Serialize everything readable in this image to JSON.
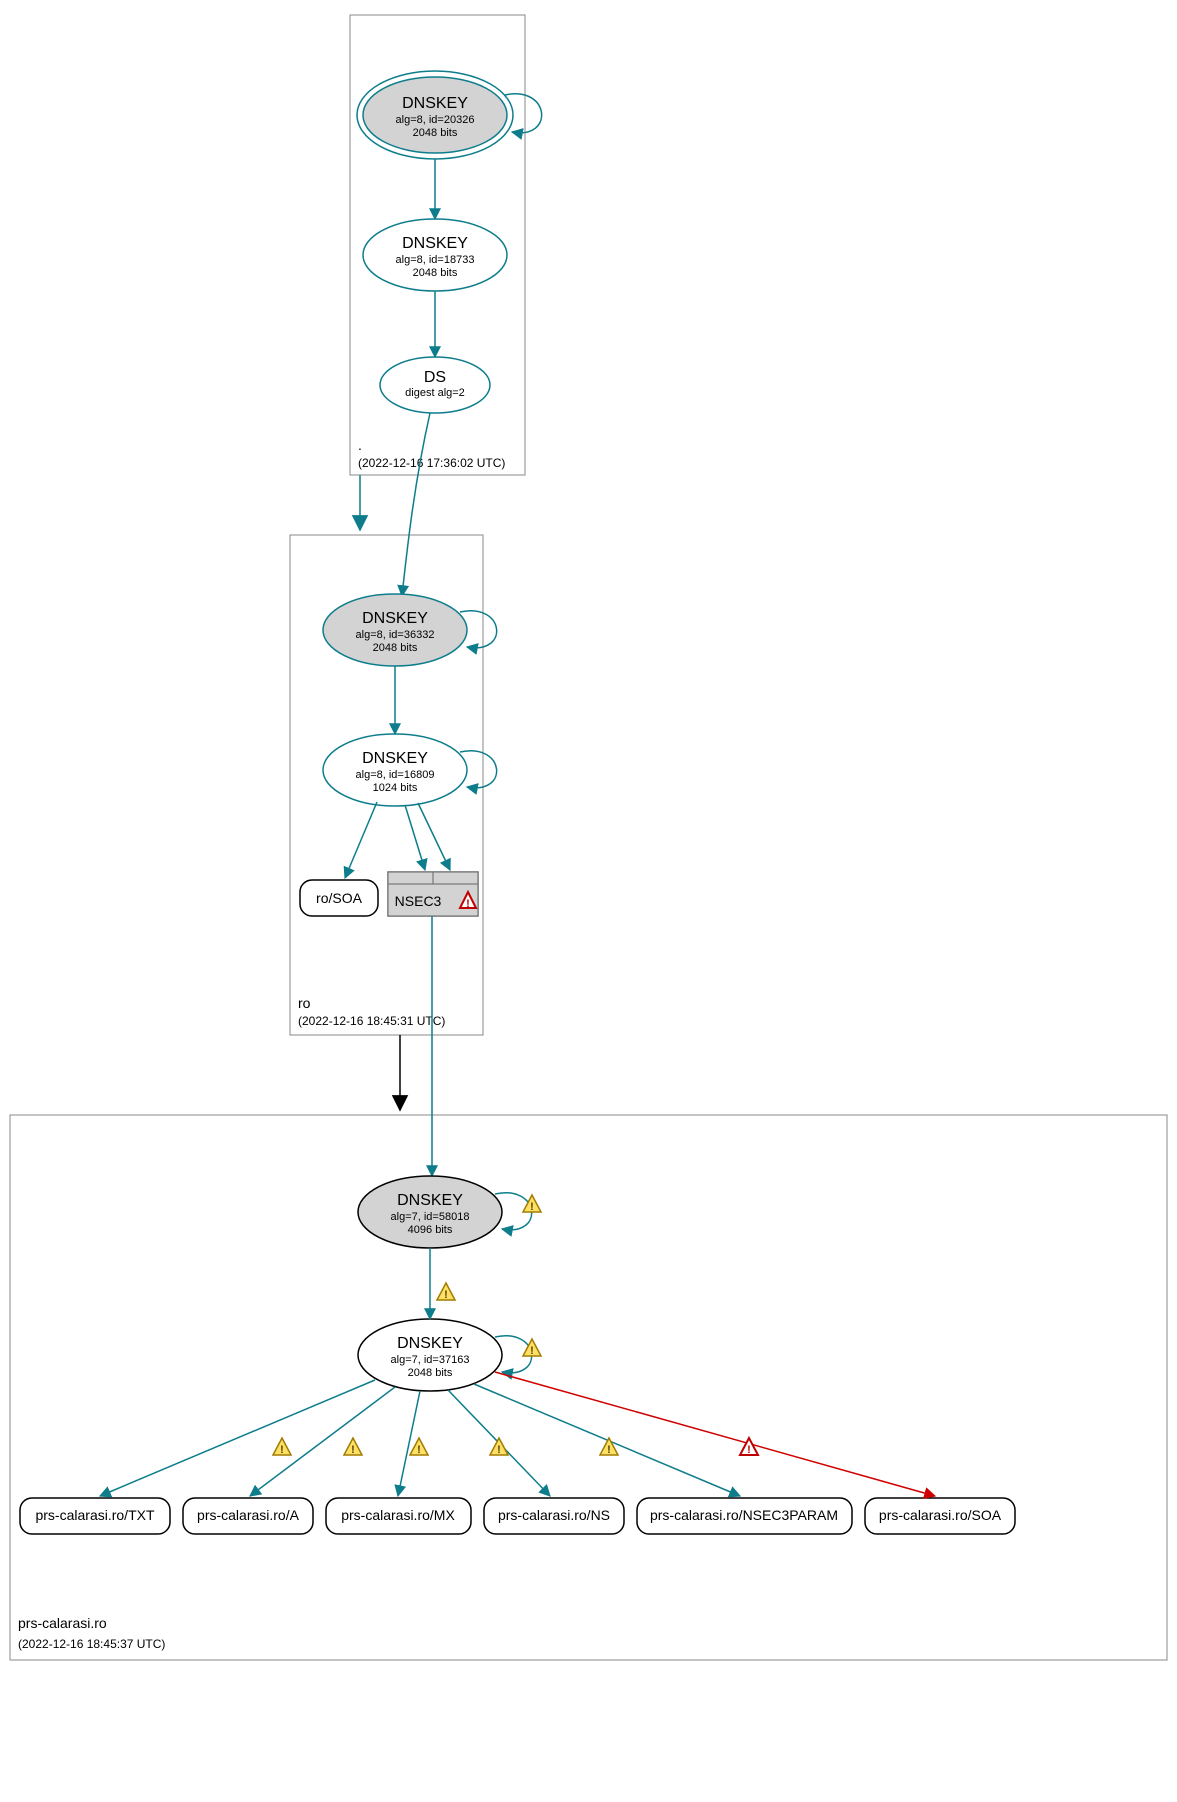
{
  "colors": {
    "teal": "#0d7d8c",
    "grayFill": "#d3d3d3",
    "black": "#000000",
    "red": "#d00000"
  },
  "zones": {
    "root": {
      "label": ".",
      "timestamp": "(2022-12-16 17:36:02 UTC)"
    },
    "ro": {
      "label": "ro",
      "timestamp": "(2022-12-16 18:45:31 UTC)"
    },
    "prs": {
      "label": "prs-calarasi.ro",
      "timestamp": "(2022-12-16 18:45:37 UTC)"
    }
  },
  "nodes": {
    "root_ksk": {
      "title": "DNSKEY",
      "line1": "alg=8, id=20326",
      "line2": "2048 bits"
    },
    "root_zsk": {
      "title": "DNSKEY",
      "line1": "alg=8, id=18733",
      "line2": "2048 bits"
    },
    "root_ds": {
      "title": "DS",
      "line1": "digest alg=2",
      "line2": ""
    },
    "ro_ksk": {
      "title": "DNSKEY",
      "line1": "alg=8, id=36332",
      "line2": "2048 bits"
    },
    "ro_zsk": {
      "title": "DNSKEY",
      "line1": "alg=8, id=16809",
      "line2": "1024 bits"
    },
    "ro_soa": {
      "title": "ro/SOA"
    },
    "ro_nsec3": {
      "title": "NSEC3"
    },
    "prs_ksk": {
      "title": "DNSKEY",
      "line1": "alg=7, id=58018",
      "line2": "4096 bits"
    },
    "prs_zsk": {
      "title": "DNSKEY",
      "line1": "alg=7, id=37163",
      "line2": "2048 bits"
    },
    "prs_txt": {
      "title": "prs-calarasi.ro/TXT"
    },
    "prs_a": {
      "title": "prs-calarasi.ro/A"
    },
    "prs_mx": {
      "title": "prs-calarasi.ro/MX"
    },
    "prs_ns": {
      "title": "prs-calarasi.ro/NS"
    },
    "prs_n3p": {
      "title": "prs-calarasi.ro/NSEC3PARAM"
    },
    "prs_soa": {
      "title": "prs-calarasi.ro/SOA"
    }
  }
}
